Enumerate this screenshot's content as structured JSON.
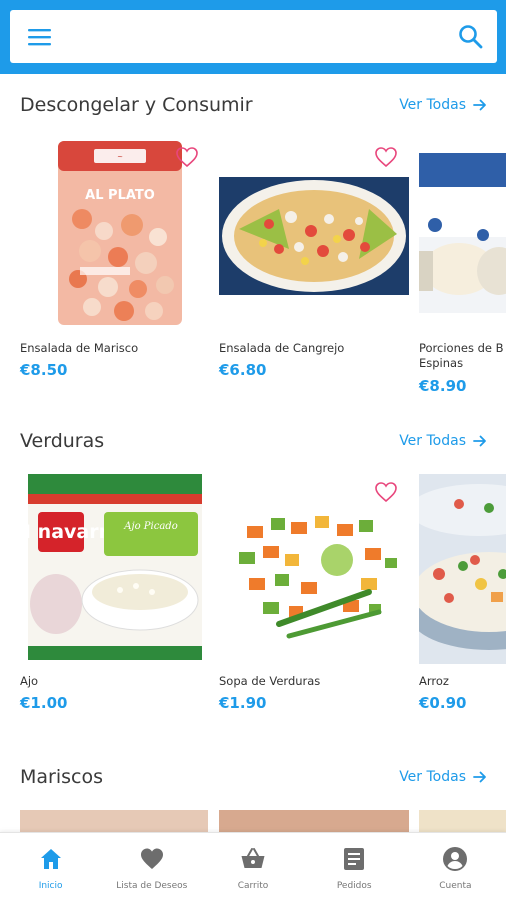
{
  "search": {
    "placeholder": ""
  },
  "sections": [
    {
      "title": "Descongelar y Consumir",
      "see_all": "Ver Todas",
      "products": [
        {
          "name": "Ensalada de Marisco",
          "price": "€8.50",
          "favorite": false
        },
        {
          "name": "Ensalada de Cangrejo",
          "price": "€6.80",
          "favorite": false
        },
        {
          "name": "Porciones de B Espinas",
          "price": "€8.90",
          "favorite": false
        }
      ]
    },
    {
      "title": "Verduras",
      "see_all": "Ver Todas",
      "products": [
        {
          "name": "Ajo",
          "price": "€1.00",
          "favorite": false,
          "pack_brand": "CN navarra",
          "pack_label": "Ajo Picado"
        },
        {
          "name": "Sopa de Verduras",
          "price": "€1.90",
          "favorite": false
        },
        {
          "name": "Arroz",
          "price": "€0.90",
          "favorite": false
        }
      ]
    },
    {
      "title": "Mariscos",
      "see_all": "Ver Todas"
    }
  ],
  "packaging": {
    "al_plato": "AL PLATO"
  },
  "bottom_nav": [
    {
      "label": "Inicio",
      "icon": "home-icon",
      "active": true
    },
    {
      "label": "Lista de Deseos",
      "icon": "heart-icon",
      "active": false
    },
    {
      "label": "Carrito",
      "icon": "basket-icon",
      "active": false
    },
    {
      "label": "Pedidos",
      "icon": "orders-icon",
      "active": false
    },
    {
      "label": "Cuenta",
      "icon": "account-icon",
      "active": false
    }
  ],
  "colors": {
    "primary": "#1e9be9",
    "favorite": "#e8467c",
    "inactive_nav": "#6d6d6d"
  }
}
